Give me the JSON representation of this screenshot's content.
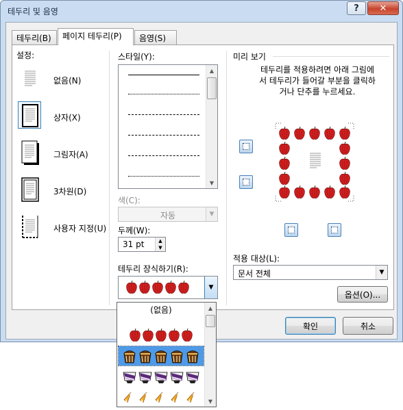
{
  "window": {
    "title": "테두리 및 음영",
    "help_label": "?",
    "close_label": "✕"
  },
  "tabs": [
    {
      "label": "테두리(B)",
      "active": false
    },
    {
      "label": "페이지 테두리(P)",
      "active": true
    },
    {
      "label": "음영(S)",
      "active": false
    }
  ],
  "setting": {
    "heading": "설정:",
    "items": [
      {
        "label": "없음(N)",
        "selected": false,
        "icon": "setting-none-icon"
      },
      {
        "label": "상자(X)",
        "selected": true,
        "icon": "setting-box-icon"
      },
      {
        "label": "그림자(A)",
        "selected": false,
        "icon": "setting-shadow-icon"
      },
      {
        "label": "3차원(D)",
        "selected": false,
        "icon": "setting-3d-icon"
      },
      {
        "label": "사용자 지정(U)",
        "selected": false,
        "icon": "setting-custom-icon"
      }
    ]
  },
  "style": {
    "heading": "스타일(Y):"
  },
  "color": {
    "label": "색(C):",
    "value": "자동",
    "disabled": true
  },
  "width": {
    "label": "두께(W):",
    "value": "31 pt"
  },
  "art": {
    "label": "테두리 장식하기(R):",
    "selected_name": "apples",
    "none_label": "(없음)",
    "options": [
      "apples",
      "cakes",
      "cupcakes",
      "candy-corn"
    ],
    "highlighted_option": "cakes"
  },
  "preview": {
    "heading": "미리 보기",
    "instruction": "테두리를 적용하려면 아래 그림에서 테두리가 들어갈 부분을 클릭하거나 단추를 누르세요."
  },
  "apply_to": {
    "label": "적용 대상(L):",
    "value": "문서 전체"
  },
  "options_button": "옵션(O)...",
  "ok_button": "확인",
  "cancel_button": "취소",
  "colors": {
    "title_bg": "#c9dcf2",
    "close_red": "#c7452d",
    "apple_red": "#d11f1f",
    "selection_blue": "#4e9ae6"
  }
}
